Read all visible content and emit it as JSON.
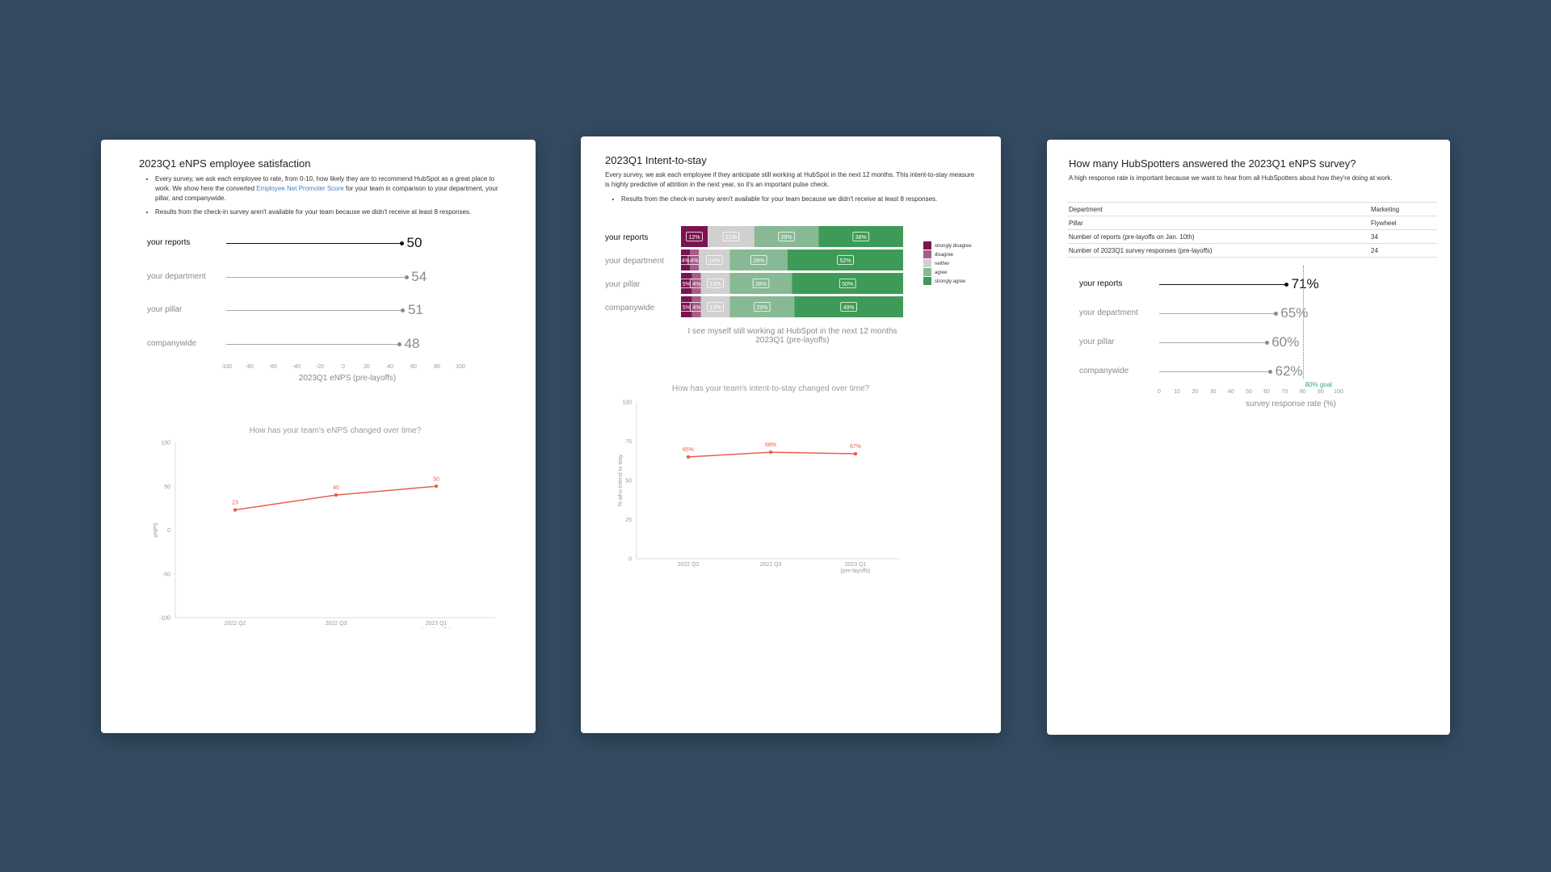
{
  "colors": {
    "background": "#334a60",
    "accent": "#e8604c",
    "link": "#4a7fb5",
    "goal": "#3aa57a",
    "strongly_disagree": "#7a1450",
    "disagree": "#a55d8a",
    "neither": "#d0d0d0",
    "agree": "#86b994",
    "strongly_agree": "#3e9b57"
  },
  "card1": {
    "title": "2023Q1 eNPS employee satisfaction",
    "bullet1_a": "Every survey, we ask each employee to rate, from 0-10, how likely they are to recommend HubSpot as a great place to work. We show here the converted ",
    "bullet1_link": "Employee Net Promoter Score",
    "bullet1_b": " for your team in comparison to your department, your pillar, and companywide.",
    "bullet2": "Results from the check-in survey aren't available for your team because we didn't receive at least 8 responses.",
    "lollipop": {
      "rows": [
        {
          "label": "your reports",
          "value": 50,
          "display": "50"
        },
        {
          "label": "your department",
          "value": 54,
          "display": "54"
        },
        {
          "label": "your pillar",
          "value": 51,
          "display": "51"
        },
        {
          "label": "companywide",
          "value": 48,
          "display": "48"
        }
      ],
      "ticks": [
        "-100",
        "-80",
        "-60",
        "-40",
        "-20",
        "0",
        "20",
        "40",
        "60",
        "80",
        "100"
      ],
      "xmin": -100,
      "xmax": 100,
      "xlabel": "2023Q1 eNPS (pre-layoffs)"
    },
    "trend": {
      "title": "How has your team's eNPS changed over time?",
      "ylabel": "eNPS",
      "yticks": [
        "100",
        "50",
        "0",
        "-50",
        "-100"
      ],
      "x": [
        "2022 Q2",
        "2022 Q3",
        "2023 Q1"
      ],
      "x_sub": [
        "",
        "",
        "(pre-layoffs)"
      ],
      "values": [
        23,
        40,
        50
      ],
      "labels": [
        "23",
        "40",
        "50"
      ],
      "ymin": -100,
      "ymax": 100
    }
  },
  "card2": {
    "title": "2023Q1 Intent-to-stay",
    "intro": "Every survey, we ask each employee if they anticipate still working at HubSpot in the next 12 months. This intent-to-stay measure is highly predictive of attrition in the next year, so it's an important pulse check.",
    "bullet": "Results from the check-in survey aren't available for your team because we didn't receive at least 8 responses.",
    "stacked": {
      "categories": [
        "strongly disagree",
        "disagree",
        "neither",
        "agree",
        "strongly agree"
      ],
      "rows": [
        {
          "label": "your reports",
          "values": [
            12,
            0,
            21,
            29,
            38
          ],
          "labels": [
            "12%",
            "",
            "21%",
            "29%",
            "38%"
          ]
        },
        {
          "label": "your department",
          "values": [
            4,
            4,
            14,
            26,
            52
          ],
          "labels": [
            "4%",
            "4%",
            "14%",
            "26%",
            "52%"
          ]
        },
        {
          "label": "your pillar",
          "values": [
            5,
            4,
            13,
            28,
            50
          ],
          "labels": [
            "5%",
            "4%",
            "13%",
            "28%",
            "50%"
          ]
        },
        {
          "label": "companywide",
          "values": [
            5,
            4,
            13,
            29,
            49
          ],
          "labels": [
            "5%",
            "4%",
            "13%",
            "29%",
            "49%"
          ]
        }
      ],
      "xlabel": "I see myself still working at HubSpot in the next 12 months",
      "xlabel2": "2023Q1 (pre-layoffs)"
    },
    "trend": {
      "title": "How has your team's intent-to-stay changed over time?",
      "ylabel": "% who intend to stay",
      "yticks": [
        "100",
        "75",
        "50",
        "25",
        "0"
      ],
      "x": [
        "2022 Q2",
        "2022 Q3",
        "2023 Q1"
      ],
      "x_sub": [
        "",
        "",
        "(pre-layoffs)"
      ],
      "values": [
        65,
        68,
        67
      ],
      "labels": [
        "65%",
        "68%",
        "67%"
      ],
      "ymin": 0,
      "ymax": 100
    }
  },
  "card3": {
    "title": "How many HubSpotters answered the 2023Q1 eNPS survey?",
    "intro": "A high response rate is important because we want to hear from all HubSpotters about how they're doing at work.",
    "table": [
      {
        "k": "Department",
        "v": "Marketing"
      },
      {
        "k": "Pillar",
        "v": "Flywheel"
      },
      {
        "k": "Number of reports (pre-layoffs on Jan. 10th)",
        "v": "34"
      },
      {
        "k": "Number of 2023Q1 survey responses (pre-layoffs)",
        "v": "24"
      }
    ],
    "lollipop": {
      "rows": [
        {
          "label": "your reports",
          "value": 71,
          "display": "71%"
        },
        {
          "label": "your department",
          "value": 65,
          "display": "65%"
        },
        {
          "label": "your pillar",
          "value": 60,
          "display": "60%"
        },
        {
          "label": "companywide",
          "value": 62,
          "display": "62%"
        }
      ],
      "ticks": [
        "0",
        "10",
        "20",
        "30",
        "40",
        "50",
        "60",
        "70",
        "80",
        "90",
        "100"
      ],
      "xmin": 0,
      "xmax": 100,
      "goal_value": 80,
      "goal_label": "80% goal",
      "xlabel": "survey response rate (%)"
    }
  }
}
